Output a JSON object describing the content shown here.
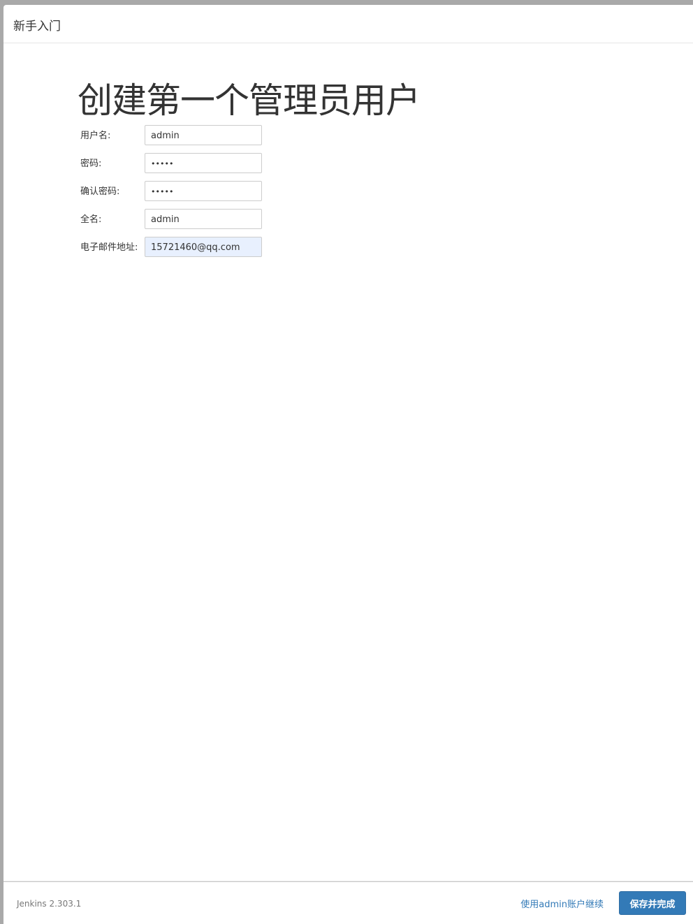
{
  "dialog": {
    "title": "新手入门"
  },
  "page": {
    "heading": "创建第一个管理员用户"
  },
  "form": {
    "fields": [
      {
        "label": "用户名:",
        "value": "admin",
        "type": "text"
      },
      {
        "label": "密码:",
        "value": "•••••",
        "type": "password"
      },
      {
        "label": "确认密码:",
        "value": "•••••",
        "type": "password"
      },
      {
        "label": "全名:",
        "value": "admin",
        "type": "text"
      },
      {
        "label": "电子邮件地址:",
        "value": "15721460@qq.com",
        "type": "email"
      }
    ]
  },
  "footer": {
    "version": "Jenkins 2.303.1",
    "continue_link": "使用admin账户继续",
    "save_button": "保存并完成"
  },
  "colors": {
    "primary": "#337ab7",
    "autofill_bg": "#e8f0fe",
    "backdrop": "#a9a9a9"
  }
}
